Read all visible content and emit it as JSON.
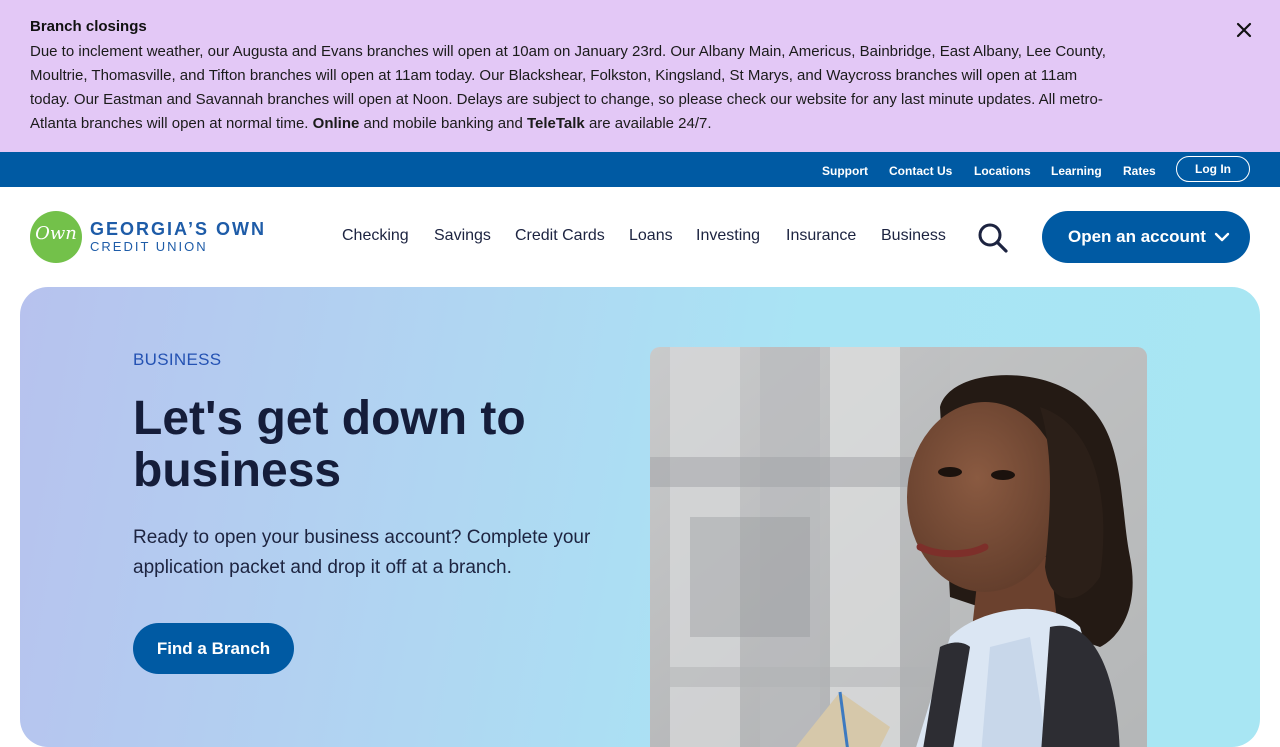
{
  "alert": {
    "title": "Branch closings",
    "body_text": "Due to inclement weather, our Augusta and Evans branches will open at 10am on January 23rd. Our Albany Main, Americus, Bainbridge, East Albany, Lee County, Moultrie, Thomasville, and Tifton branches will open at 11am today. Our Blackshear, Folkston, Kingsland, St Marys, and Waycross branches will open at 11am today. Our Eastman and Savannah branches will open at Noon. Delays are subject to change, so please check our website for any last minute updates. All metro-Atlanta branches will open at normal time.",
    "body_online": "Online",
    "body_and_mobile": "and mobile banking and",
    "body_teletalk": "TeleTalk",
    "body_end": "are available 24/7."
  },
  "utility_nav": {
    "support": "Support",
    "contact": "Contact Us",
    "locations": "Locations",
    "learning": "Learning",
    "rates": "Rates",
    "login": "Log In"
  },
  "logo": {
    "script": "Own",
    "name": "GEORGIA’S OWN",
    "sub": "CREDIT UNION"
  },
  "main_nav": {
    "checking": "Checking",
    "savings": "Savings",
    "credit_cards": "Credit Cards",
    "loans": "Loans",
    "investing": "Investing",
    "insurance": "Insurance",
    "business": "Business",
    "open_account": "Open an account"
  },
  "hero": {
    "eyebrow": "BUSINESS",
    "headline": "Let's get down to business",
    "subtext": "Ready to open your business account? Complete your application packet and drop it off at a branch.",
    "cta": "Find a Branch"
  },
  "colors": {
    "alert_bg": "#e3c8f6",
    "brand_blue": "#005aa3",
    "logo_green": "#73c14a"
  }
}
